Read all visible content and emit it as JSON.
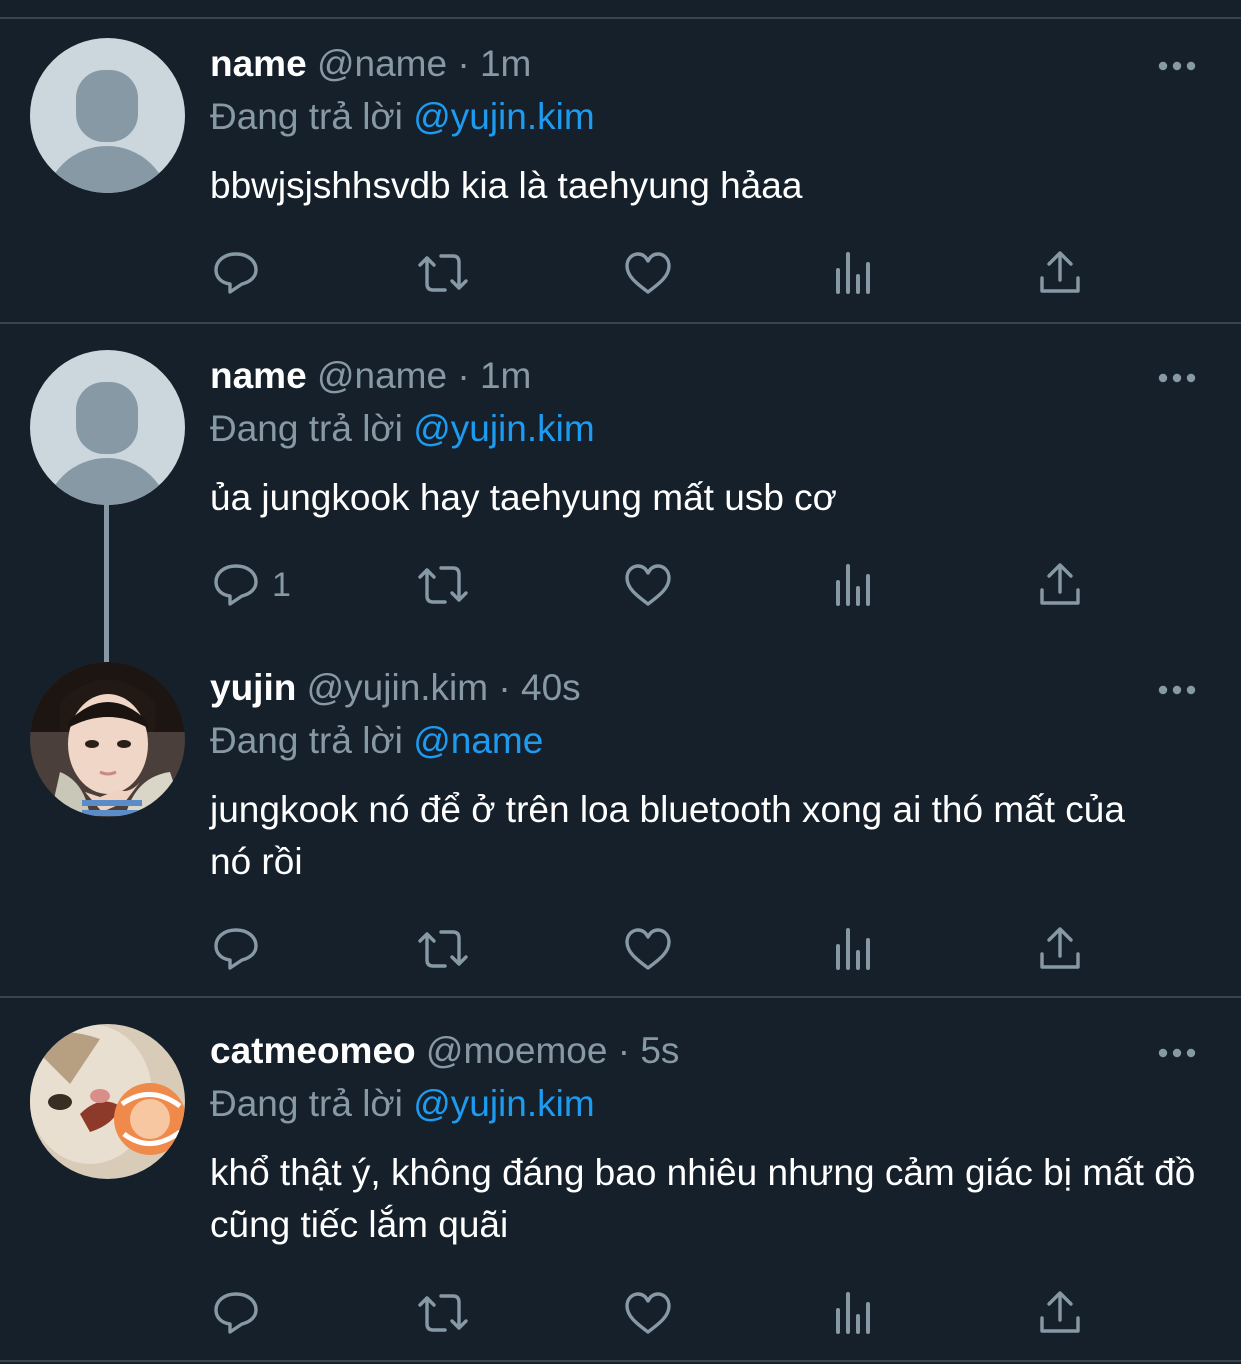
{
  "tweets": [
    {
      "name": "name",
      "handle": "@name",
      "separator": "·",
      "time": "1m",
      "reply_prefix": "Đang trả lời",
      "reply_to": "@yujin.kim",
      "text": "bbwjsjshhsvdb kia là taehyung hảaa",
      "reply_count": "",
      "avatar": "default-avatar"
    },
    {
      "name": "name",
      "handle": "@name",
      "separator": "·",
      "time": "1m",
      "reply_prefix": "Đang trả lời",
      "reply_to": "@yujin.kim",
      "text": "ủa jungkook hay taehyung mất usb cơ",
      "reply_count": "1",
      "avatar": "default-avatar"
    },
    {
      "name": "yujin",
      "handle": "@yujin.kim",
      "separator": "·",
      "time": "40s",
      "reply_prefix": "Đang trả lời",
      "reply_to": "@name",
      "text": "jungkook nó để ở trên loa bluetooth xong ai thó mất của nó rồi",
      "reply_count": "",
      "avatar": "photo-avatar"
    },
    {
      "name": "catmeomeo",
      "handle": "@moemoe",
      "separator": "·",
      "time": "5s",
      "reply_prefix": "Đang trả lời",
      "reply_to": "@yujin.kim",
      "text": "khổ thật ý, không đáng bao nhiêu nhưng cảm giác bị mất đồ cũng tiếc lắm quãi",
      "reply_count": "",
      "avatar": "cat-avatar"
    }
  ],
  "icons": [
    "more-icon",
    "reply-icon",
    "retweet-icon",
    "like-icon",
    "analytics-icon",
    "share-icon"
  ],
  "colors": {
    "background": "#15202b",
    "divider": "#38444d",
    "secondary_text": "#8899a6",
    "link": "#1d9bf0",
    "primary_text": "#ffffff"
  }
}
